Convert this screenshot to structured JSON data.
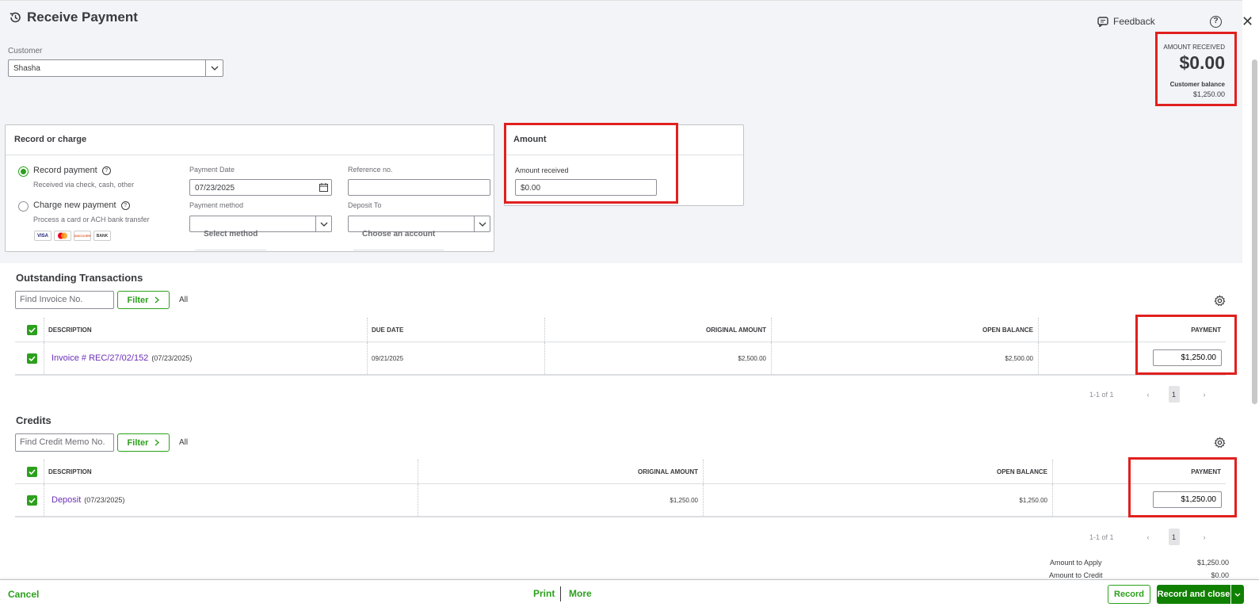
{
  "header": {
    "title": "Receive Payment",
    "feedback_label": "Feedback",
    "help_glyph": "?",
    "close_glyph": "✕"
  },
  "customer": {
    "label": "Customer",
    "value": "Shasha"
  },
  "summary_box": {
    "label": "AMOUNT RECEIVED",
    "amount": "$0.00",
    "balance_label": "Customer balance",
    "balance_value": "$1,250.00"
  },
  "record_panel": {
    "title": "Record or charge",
    "option1_label": "Record payment",
    "option1_sub": "Received via check, cash, other",
    "option2_label": "Charge new payment",
    "option2_sub": "Process a card or ACH bank transfer",
    "cards": [
      "VISA",
      "MC",
      "DISCOVER",
      "BANK"
    ],
    "payment_date_label": "Payment Date",
    "payment_date_value": "07/23/2025",
    "reference_label": "Reference no.",
    "reference_value": "",
    "payment_method_label": "Payment method",
    "payment_method_placeholder": "Select method",
    "deposit_to_label": "Deposit To",
    "deposit_to_placeholder": "Choose an account"
  },
  "amount_panel": {
    "title": "Amount",
    "received_label": "Amount received",
    "received_value": "$0.00"
  },
  "outstanding": {
    "title": "Outstanding Transactions",
    "search_placeholder": "Find Invoice No.",
    "filter_label": "Filter",
    "all_label": "All",
    "columns": [
      "DESCRIPTION",
      "DUE DATE",
      "ORIGINAL AMOUNT",
      "OPEN BALANCE",
      "PAYMENT"
    ],
    "rows": [
      {
        "description": "Invoice # REC/27/02/152",
        "date": "(07/23/2025)",
        "due_date": "09/21/2025",
        "original": "$2,500.00",
        "open": "$2,500.00",
        "payment": "$1,250.00"
      }
    ],
    "pager_text": "1-1 of 1",
    "page": "1"
  },
  "credits": {
    "title": "Credits",
    "search_placeholder": "Find Credit Memo No.",
    "filter_label": "Filter",
    "all_label": "All",
    "columns": [
      "DESCRIPTION",
      "ORIGINAL AMOUNT",
      "OPEN BALANCE",
      "PAYMENT"
    ],
    "rows": [
      {
        "description": "Deposit",
        "date": "(07/23/2025)",
        "original": "$1,250.00",
        "open": "$1,250.00",
        "payment": "$1,250.00"
      }
    ],
    "pager_text": "1-1 of 1",
    "page": "1"
  },
  "totals": {
    "apply_label": "Amount to Apply",
    "apply_value": "$1,250.00",
    "credit_label": "Amount to Credit",
    "credit_value": "$0.00"
  },
  "footer": {
    "cancel": "Cancel",
    "print": "Print",
    "more": "More",
    "record": "Record",
    "record_close": "Record and close"
  },
  "colors": {
    "accent_green": "#2ca01c",
    "primary_button": "#108000",
    "highlight_red": "#e0201e",
    "link_purple": "#6b2fb8"
  }
}
